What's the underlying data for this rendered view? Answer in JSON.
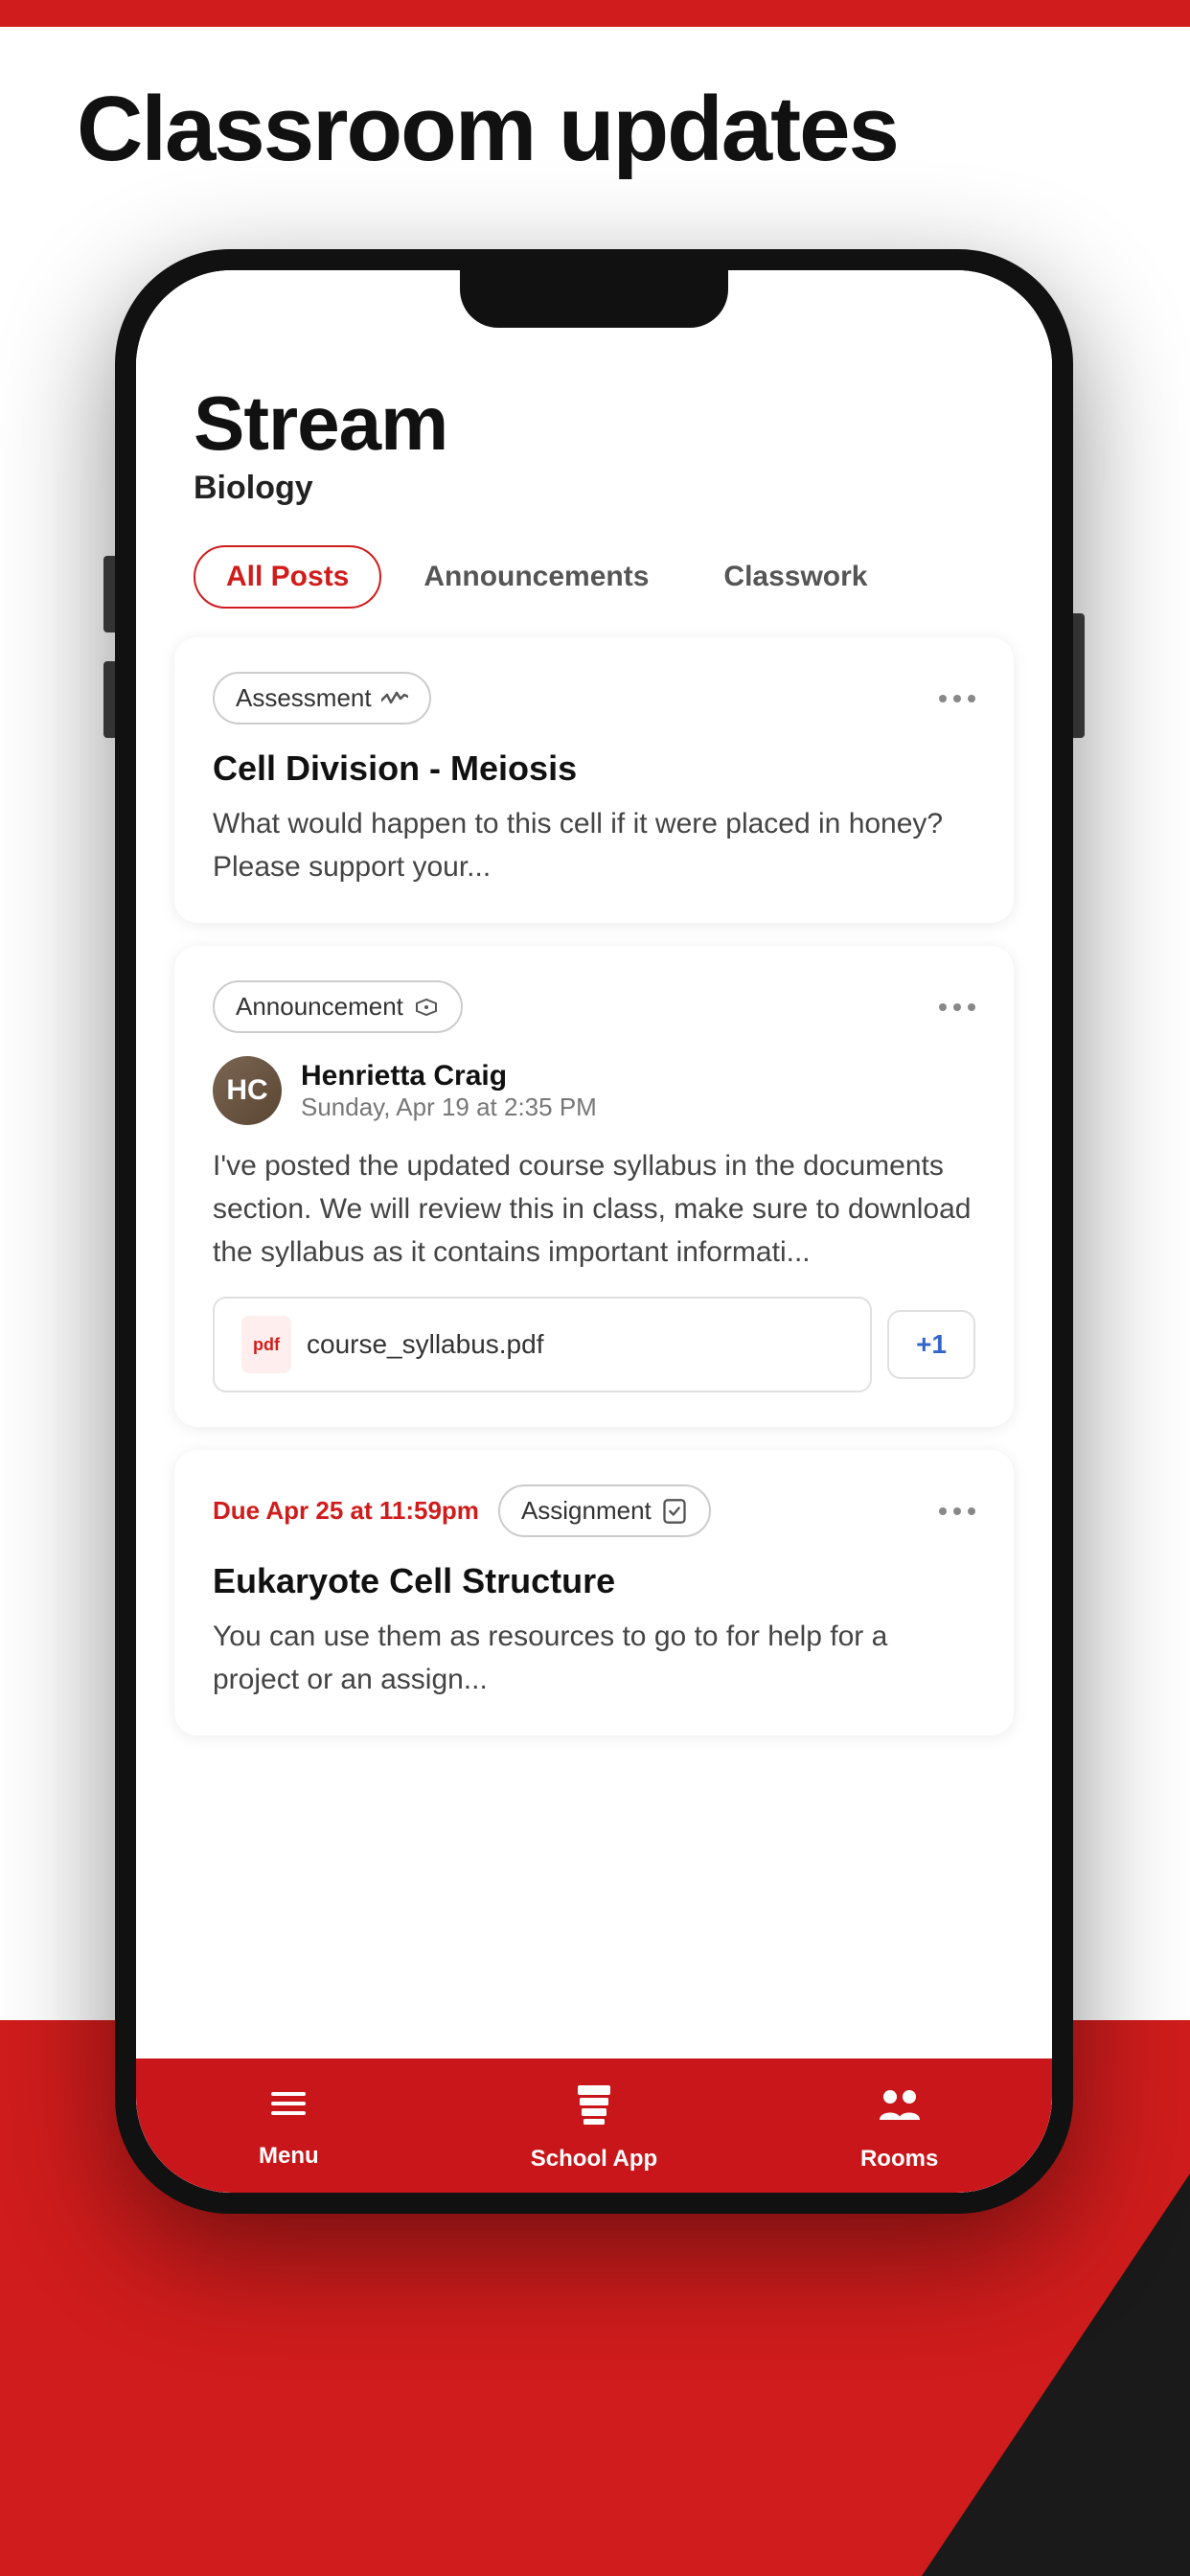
{
  "page": {
    "title": "Classroom updates",
    "colors": {
      "red": "#d01c1c",
      "dark": "#111111",
      "white": "#ffffff"
    }
  },
  "stream": {
    "title": "Stream",
    "subtitle": "Biology"
  },
  "tabs": [
    {
      "label": "All Posts",
      "active": true
    },
    {
      "label": "Announcements",
      "active": false
    },
    {
      "label": "Classwork",
      "active": false
    }
  ],
  "cards": [
    {
      "badge": "Assessment",
      "badgeIconType": "assessment",
      "title": "Cell Division - Meiosis",
      "body": "What would happen to this cell if it were placed in honey? Please support your...",
      "type": "assessment"
    },
    {
      "badge": "Announcement",
      "badgeIconType": "announcement",
      "authorName": "Henrietta Craig",
      "authorDate": "Sunday, Apr 19 at 2:35 PM",
      "body": "I've posted the updated course syllabus in the documents section. We will review this in class, make sure to download the syllabus as it contains important informati...",
      "attachment": "course_syllabus.pdf",
      "plusCount": "+1",
      "type": "announcement"
    },
    {
      "badge": "Assignment",
      "badgeIconType": "assignment",
      "dueDate": "Due Apr 25 at 11:59pm",
      "title": "Eukaryote Cell Structure",
      "body": "You can use them as resources to go to for help for a project or an assign...",
      "type": "assignment"
    }
  ],
  "bottomNav": [
    {
      "label": "Menu",
      "iconType": "menu"
    },
    {
      "label": "School App",
      "iconType": "schoolapp"
    },
    {
      "label": "Rooms",
      "iconType": "rooms"
    }
  ]
}
